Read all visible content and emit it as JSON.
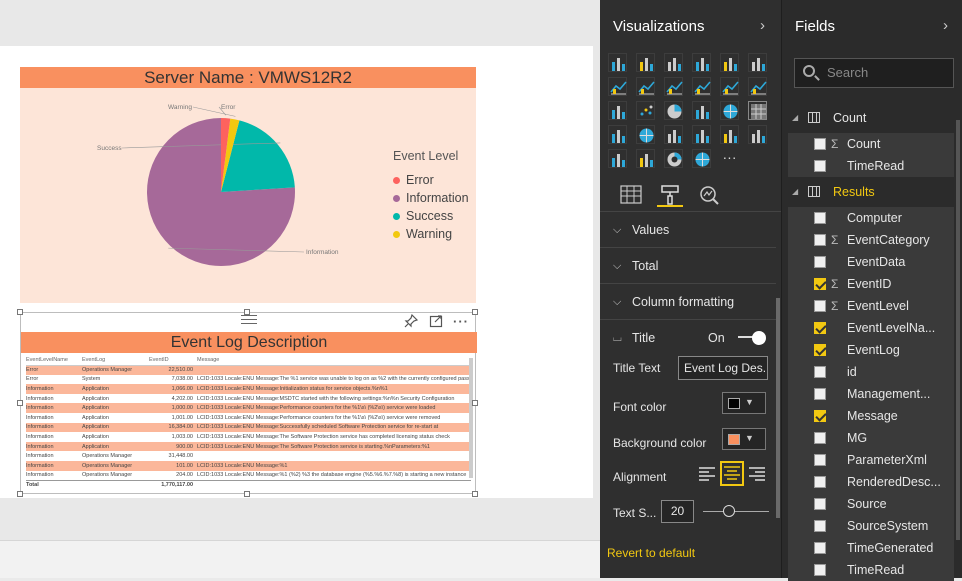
{
  "pie_visual": {
    "title": "Server Name : VMWS12R2",
    "legend_title": "Event Level",
    "colors": {
      "Error": "#fd625e",
      "Information": "#a66999",
      "Success": "#01b8aa",
      "Warning": "#f2c80f"
    }
  },
  "chart_data": {
    "type": "pie",
    "title": "Server Name : VMWS12R2",
    "legend": {
      "title": "Event Level",
      "position": "right",
      "entries": [
        "Error",
        "Information",
        "Success",
        "Warning"
      ]
    },
    "slices": [
      {
        "label": "Information",
        "value": 76.0,
        "color": "#a66999"
      },
      {
        "label": "Success",
        "value": 20.0,
        "color": "#01b8aa"
      },
      {
        "label": "Warning",
        "value": 2.0,
        "color": "#f2c80f"
      },
      {
        "label": "Error",
        "value": 2.0,
        "color": "#fd625e"
      }
    ]
  },
  "table_visual": {
    "title": "Event Log Description",
    "columns": [
      "EventLevelName",
      "EventLog",
      "EventID",
      "Message"
    ],
    "rows": [
      [
        "Error",
        "Operations Manager",
        "22,510.00",
        ""
      ],
      [
        "Error",
        "System",
        "7,038.00",
        "LCID:1033 Locale:ENU Message:The %1 service was unable to log on as %2 with the currently configured password due to the following error:"
      ],
      [
        "Information",
        "Application",
        "1,066.00",
        "LCID:1033 Locale:ENU Message:Initialization status for service objects.%n%1"
      ],
      [
        "Information",
        "Application",
        "4,202.00",
        "LCID:1033 Locale:ENU Message:MSDTC started with the following settings:%n%n Security Configuration"
      ],
      [
        "Information",
        "Application",
        "1,000.00",
        "LCID:1033 Locale:ENU Message:Performance counters for the %1\\s\\ (%2\\s\\) service were loaded"
      ],
      [
        "Information",
        "Application",
        "1,001.00",
        "LCID:1033 Locale:ENU Message:Performance counters for the %1\\s\\ (%2\\s\\) service were removed"
      ],
      [
        "Information",
        "Application",
        "16,384.00",
        "LCID:1033 Locale:ENU Message:Successfully scheduled Software Protection service for re-start at"
      ],
      [
        "Information",
        "Application",
        "1,003.00",
        "LCID:1033 Locale:ENU Message:The Software Protection service has completed licensing status check"
      ],
      [
        "Information",
        "Application",
        "900.00",
        "LCID:1033 Locale:ENU Message:The Software Protection service is starting.%nParameters:%1"
      ],
      [
        "Information",
        "Operations Manager",
        "31,448.00",
        ""
      ],
      [
        "Information",
        "Operations Manager",
        "101.00",
        "LCID:1033 Locale:ENU Message:%1"
      ],
      [
        "Information",
        "Operations Manager",
        "204.00",
        "LCID:1033 Locale:ENU Message:%1 (%2) %3 the database engine (%5.%6.%7.%8) is starting a new instance"
      ]
    ],
    "total_label": "Total",
    "total_value": "1,770,117.00"
  },
  "viz_pane": {
    "title": "Visualizations",
    "sections": [
      "Values",
      "Total",
      "Column formatting"
    ],
    "title_section": {
      "label": "Title",
      "toggle_label": "On",
      "title_text_label": "Title Text",
      "title_text_value": "Event Log Des...",
      "font_color_label": "Font color",
      "font_color": "#000000",
      "bg_color_label": "Background color",
      "bg_color": "#f9905f",
      "alignment_label": "Alignment",
      "text_size_label": "Text S...",
      "text_size": "20"
    },
    "revert": "Revert to default"
  },
  "fields_pane": {
    "title": "Fields",
    "search_placeholder": "Search",
    "tables": [
      {
        "name": "Count",
        "fields": [
          {
            "name": "Count",
            "sigma": true,
            "checked": false
          },
          {
            "name": "TimeRead",
            "sigma": false,
            "checked": false
          }
        ]
      },
      {
        "name": "Results",
        "fields": [
          {
            "name": "Computer",
            "sigma": false,
            "checked": false
          },
          {
            "name": "EventCategory",
            "sigma": true,
            "checked": false
          },
          {
            "name": "EventData",
            "sigma": false,
            "checked": false
          },
          {
            "name": "EventID",
            "sigma": true,
            "checked": true
          },
          {
            "name": "EventLevel",
            "sigma": true,
            "checked": false
          },
          {
            "name": "EventLevelNa...",
            "sigma": false,
            "checked": true
          },
          {
            "name": "EventLog",
            "sigma": false,
            "checked": true
          },
          {
            "name": "id",
            "sigma": false,
            "checked": false
          },
          {
            "name": "Management...",
            "sigma": false,
            "checked": false
          },
          {
            "name": "Message",
            "sigma": false,
            "checked": true
          },
          {
            "name": "MG",
            "sigma": false,
            "checked": false
          },
          {
            "name": "ParameterXml",
            "sigma": false,
            "checked": false
          },
          {
            "name": "RenderedDesc...",
            "sigma": false,
            "checked": false
          },
          {
            "name": "Source",
            "sigma": false,
            "checked": false
          },
          {
            "name": "SourceSystem",
            "sigma": false,
            "checked": false
          },
          {
            "name": "TimeGenerated",
            "sigma": false,
            "checked": false
          },
          {
            "name": "TimeRead",
            "sigma": false,
            "checked": false
          }
        ]
      }
    ]
  }
}
